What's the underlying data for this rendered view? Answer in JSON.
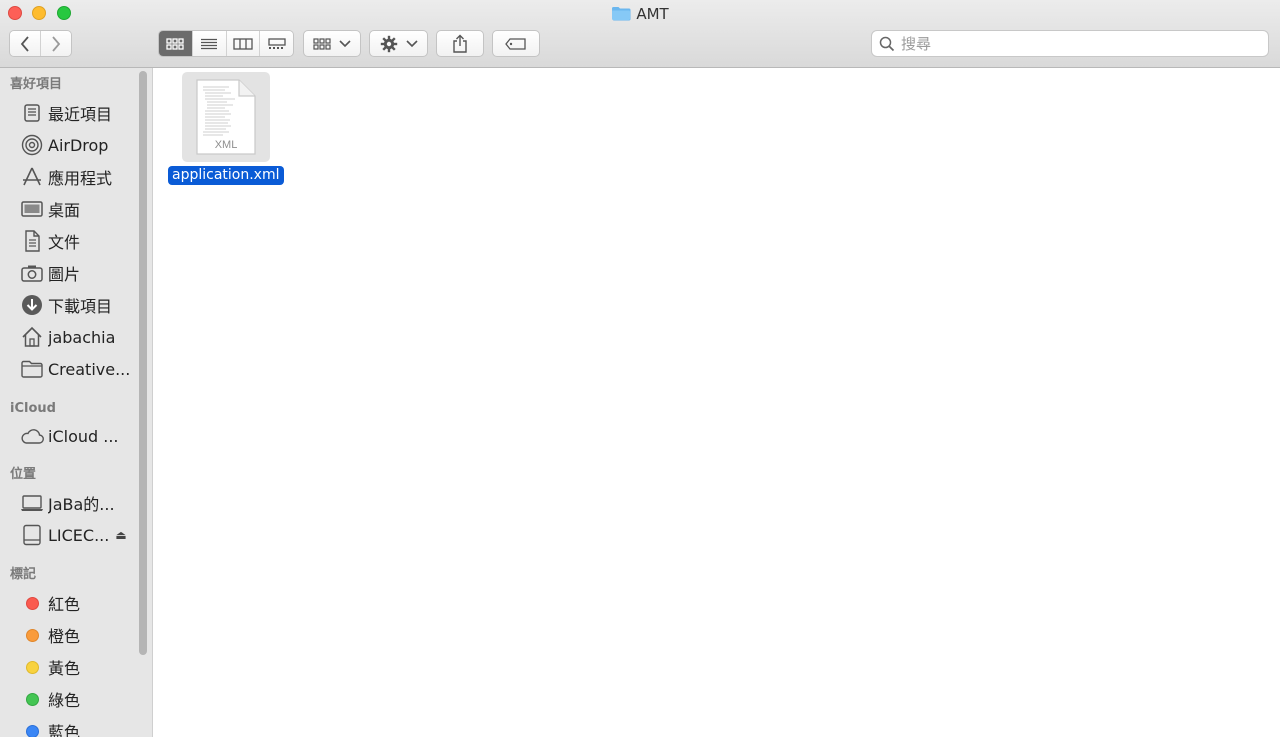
{
  "window": {
    "title": "AMT",
    "title_icon": "folder-icon"
  },
  "toolbar": {
    "back_icon": "chevron-left-icon",
    "forward_icon": "chevron-right-icon",
    "view_modes": [
      "icon-view",
      "list-view",
      "column-view",
      "gallery-view"
    ],
    "active_view": "icon-view",
    "group_icon": "group-by-icon",
    "action_icon": "gear-icon",
    "share_icon": "share-icon",
    "tag_icon": "tag-icon",
    "search_placeholder": "搜尋"
  },
  "sidebar": {
    "favorites_header": "喜好項目",
    "favorites": [
      {
        "label": "最近項目",
        "icon": "recents-icon"
      },
      {
        "label": "AirDrop",
        "icon": "airdrop-icon"
      },
      {
        "label": "應用程式",
        "icon": "applications-icon"
      },
      {
        "label": "桌面",
        "icon": "desktop-icon"
      },
      {
        "label": "文件",
        "icon": "documents-icon"
      },
      {
        "label": "圖片",
        "icon": "pictures-icon"
      },
      {
        "label": "下載項目",
        "icon": "downloads-icon"
      },
      {
        "label": "jabachia",
        "icon": "home-icon"
      },
      {
        "label": "Creative...",
        "icon": "folder-icon"
      }
    ],
    "icloud_header": "iCloud",
    "icloud": [
      {
        "label": "iCloud ...",
        "icon": "cloud-icon"
      }
    ],
    "locations_header": "位置",
    "locations": [
      {
        "label": "JaBa的...",
        "icon": "laptop-icon"
      },
      {
        "label": "LICEC...",
        "icon": "drive-icon",
        "eject": "⏏"
      }
    ],
    "tags_header": "標記",
    "tags": [
      {
        "label": "紅色",
        "color": "#fa5a4f"
      },
      {
        "label": "橙色",
        "color": "#f99b3b"
      },
      {
        "label": "黃色",
        "color": "#f8d23f"
      },
      {
        "label": "綠色",
        "color": "#44c553"
      },
      {
        "label": "藍色",
        "color": "#3a86f5"
      }
    ]
  },
  "content": {
    "files": [
      {
        "name": "application.xml",
        "type_label": "XML",
        "selected": true,
        "icon": "xml-document-icon"
      }
    ]
  }
}
